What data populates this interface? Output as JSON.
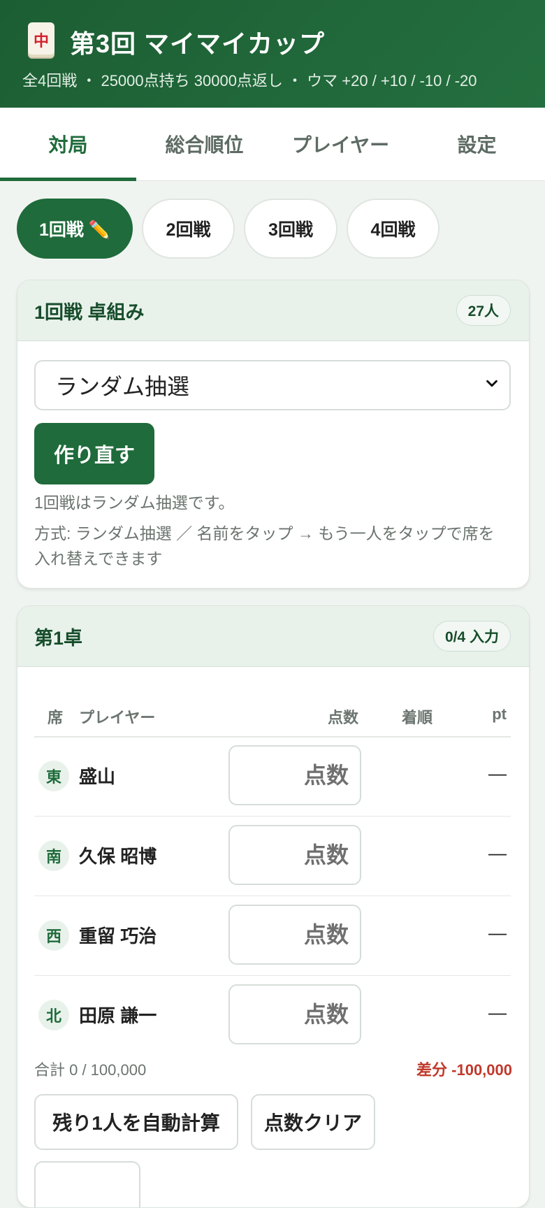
{
  "header": {
    "logo_glyph": "中",
    "title": "第3回 マイマイカップ",
    "subtitle": "全4回戦 ・ 25000点持ち 30000点返し ・ ウマ +20 / +10 / -10 / -20"
  },
  "tabs": [
    {
      "label": "対局",
      "active": true
    },
    {
      "label": "総合順位",
      "active": false
    },
    {
      "label": "プレイヤー",
      "active": false
    },
    {
      "label": "設定",
      "active": false
    }
  ],
  "rounds": [
    {
      "label": "1回戦 ✏️",
      "active": true
    },
    {
      "label": "2回戦",
      "active": false
    },
    {
      "label": "3回戦",
      "active": false
    },
    {
      "label": "4回戦",
      "active": false
    }
  ],
  "pairing": {
    "title": "1回戦 卓組み",
    "count_badge": "27人",
    "method_selected": "ランダム抽選",
    "rebuild_label": "作り直す",
    "note1": "1回戦はランダム抽選です。",
    "note2": "方式: ランダム抽選 ／ 名前をタップ → もう一人をタップで席を入れ替えできます"
  },
  "table1": {
    "title": "第1卓",
    "input_badge": "0/4 入力",
    "columns": {
      "seat": "席",
      "player": "プレイヤー",
      "score": "点数",
      "rank": "着順",
      "pt": "pt"
    },
    "rows": [
      {
        "seat": "東",
        "name": "盛山",
        "score_placeholder": "点数",
        "rank": "",
        "pt": "—"
      },
      {
        "seat": "南",
        "name": "久保 昭博",
        "score_placeholder": "点数",
        "rank": "",
        "pt": "—"
      },
      {
        "seat": "西",
        "name": "重留 巧治",
        "score_placeholder": "点数",
        "rank": "",
        "pt": "—"
      },
      {
        "seat": "北",
        "name": "田原 謙一",
        "score_placeholder": "点数",
        "rank": "",
        "pt": "—"
      }
    ],
    "total": "合計 0 / 100,000",
    "diff": "差分 -100,000",
    "auto_calc_label": "残り1人を自動計算",
    "clear_label": "点数クリア"
  },
  "colors": {
    "brand_green": "#1f6b3b",
    "header_green": "#1c5e33",
    "diff_red": "#c0392b",
    "tile_red": "#d3212e"
  }
}
